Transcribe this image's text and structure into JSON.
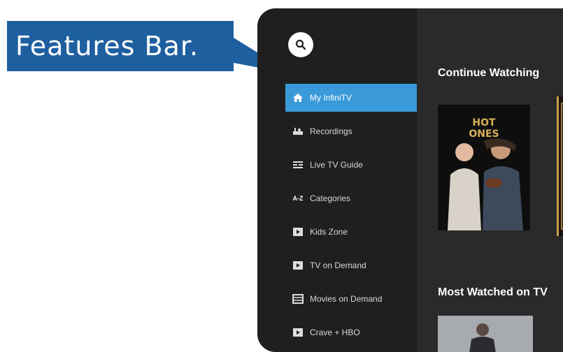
{
  "callout": {
    "label": "Features Bar."
  },
  "colors": {
    "callout_bg": "#1e5fa0",
    "active_bg": "#3a9ad9",
    "sidebar_bg": "#1f1f1f"
  },
  "search": {
    "icon": "search-icon"
  },
  "nav": {
    "items": [
      {
        "label": "My InfiniTV",
        "icon": "home-icon",
        "active": true
      },
      {
        "label": "Recordings",
        "icon": "recordings-icon"
      },
      {
        "label": "Live TV Guide",
        "icon": "guide-icon"
      },
      {
        "label": "Categories",
        "icon": "az-icon",
        "icon_text": "A-Z"
      },
      {
        "label": "Kids Zone",
        "icon": "play-icon"
      },
      {
        "label": "TV on Demand",
        "icon": "play-icon"
      },
      {
        "label": "Movies on Demand",
        "icon": "film-icon"
      },
      {
        "label": "Crave + HBO",
        "icon": "play-icon"
      }
    ]
  },
  "main": {
    "continue_watching": "Continue Watching",
    "most_watched": "Most Watched on TV",
    "poster1_title": "HOT ONES"
  }
}
